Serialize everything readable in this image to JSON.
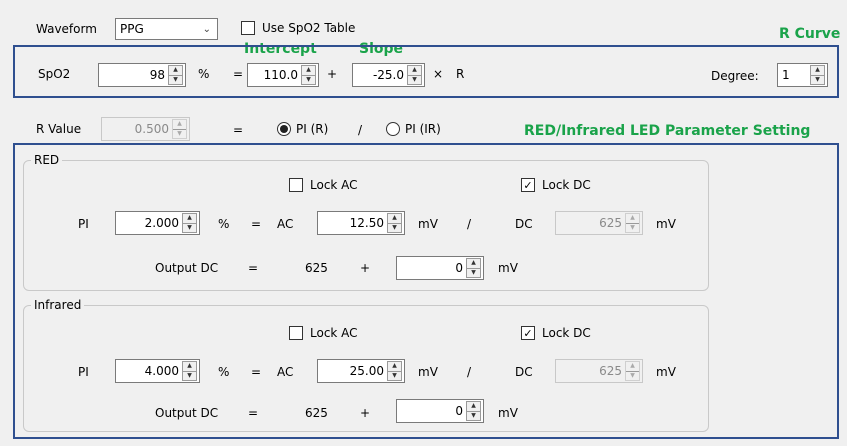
{
  "top": {
    "waveform_label": "Waveform",
    "waveform_value": "PPG",
    "use_table_label": "Use SpO2 Table",
    "use_table_checked": false
  },
  "annotations": {
    "r_curve": "R Curve",
    "intercept": "Intercept",
    "slope": "Slope",
    "led_setting": "RED/Infrared LED Parameter Setting"
  },
  "r_curve": {
    "spo2_label": "SpO2",
    "spo2_value": "98",
    "percent": "%",
    "equals": "=",
    "intercept_value": "110.0",
    "plus": "+",
    "slope_value": "-25.0",
    "times": "×",
    "r_label": "R",
    "degree_label": "Degree:",
    "degree_value": "1"
  },
  "r_value": {
    "label": "R Value",
    "value": "0.500",
    "equals": "=",
    "option_red": "PI (R)",
    "slash": "/",
    "option_ir": "PI (IR)",
    "selected": "PI (R)"
  },
  "red": {
    "title": "RED",
    "lock_ac_label": "Lock AC",
    "lock_ac_checked": false,
    "lock_dc_label": "Lock DC",
    "lock_dc_checked": true,
    "pi_label": "PI",
    "pi_value": "2.000",
    "percent": "%",
    "equals": "=",
    "ac_label": "AC",
    "ac_value": "12.50",
    "mv1": "mV",
    "slash": "/",
    "dc_label": "DC",
    "dc_value": "625",
    "mv2": "mV",
    "output_dc_label": "Output DC",
    "equals2": "=",
    "output_dc_base": "625",
    "plus": "+",
    "offset_value": "0",
    "mv3": "mV"
  },
  "infrared": {
    "title": "Infrared",
    "lock_ac_label": "Lock AC",
    "lock_ac_checked": false,
    "lock_dc_label": "Lock DC",
    "lock_dc_checked": true,
    "pi_label": "PI",
    "pi_value": "4.000",
    "percent": "%",
    "equals": "=",
    "ac_label": "AC",
    "ac_value": "25.00",
    "mv1": "mV",
    "slash": "/",
    "dc_label": "DC",
    "dc_value": "625",
    "mv2": "mV",
    "output_dc_label": "Output DC",
    "equals2": "=",
    "output_dc_base": "625",
    "plus": "+",
    "offset_value": "0",
    "mv3": "mV"
  },
  "colors": {
    "annotation_green": "#1aa34a",
    "r_curve_border": "#2f4f8f"
  }
}
